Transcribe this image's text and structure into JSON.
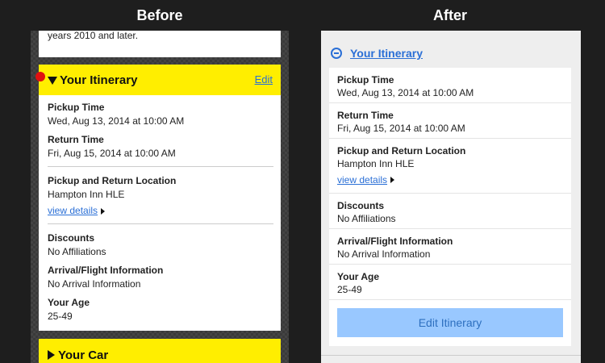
{
  "headings": {
    "before": "Before",
    "after": "After"
  },
  "before": {
    "top_text": "years 2010 and later.",
    "header_title": "Your Itinerary",
    "edit_link": "Edit",
    "pickup": {
      "label": "Pickup Time",
      "value": "Wed, Aug 13, 2014 at 10:00 AM"
    },
    "return": {
      "label": "Return Time",
      "value": "Fri, Aug 15, 2014 at 10:00 AM"
    },
    "location": {
      "label": "Pickup and Return Location",
      "value": "Hampton Inn HLE",
      "link": "view details"
    },
    "discounts": {
      "label": "Discounts",
      "value": "No Affiliations"
    },
    "arrival": {
      "label": "Arrival/Flight Information",
      "value": "No Arrival Information"
    },
    "age": {
      "label": "Your Age",
      "value": "25-49"
    },
    "car_title": "Your Car"
  },
  "after": {
    "header_title": "Your Itinerary",
    "pickup": {
      "label": "Pickup Time",
      "value": "Wed, Aug 13, 2014 at 10:00 AM"
    },
    "return": {
      "label": "Return Time",
      "value": "Fri, Aug 15, 2014 at 10:00 AM"
    },
    "location": {
      "label": "Pickup and Return Location",
      "value": "Hampton Inn HLE",
      "link": "view details"
    },
    "discounts": {
      "label": "Discounts",
      "value": "No Affiliations"
    },
    "arrival": {
      "label": "Arrival/Flight Information",
      "value": "No Arrival Information"
    },
    "age": {
      "label": "Your Age",
      "value": "25-49"
    },
    "button": "Edit Itinerary"
  },
  "colors": {
    "yellow": "#ffee00",
    "link_blue": "#2a6fd6",
    "button_bg": "#99c8ff",
    "dark_bg": "#1e1e1e"
  }
}
